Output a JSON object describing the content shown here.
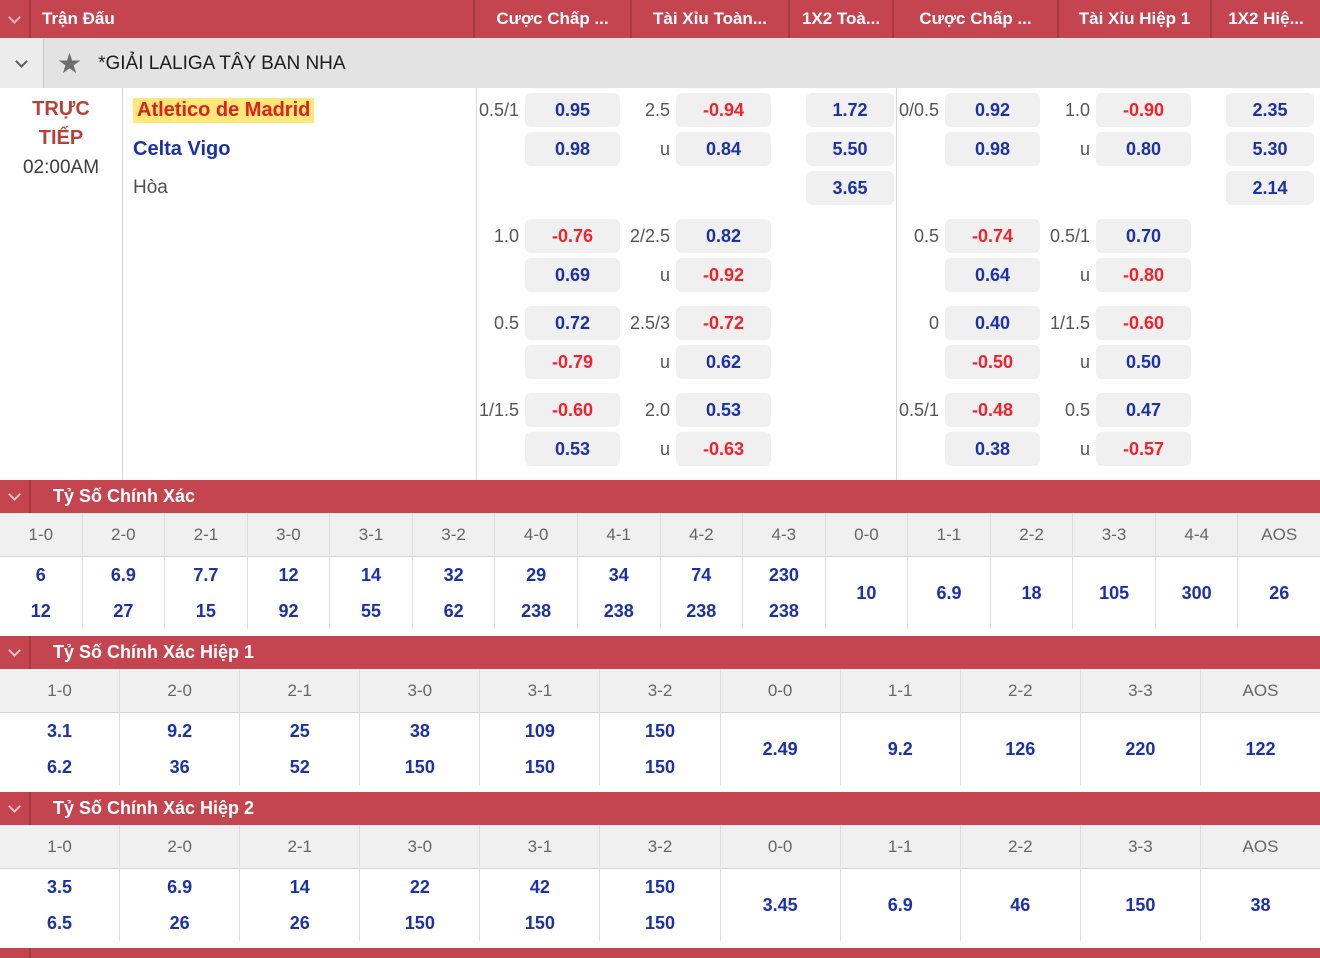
{
  "header": {
    "columns": [
      "Trận Đấu",
      "Cược Chấp ...",
      "Tài Xỉu Toàn...",
      "1X2 Toà...",
      "Cược Chấp ...",
      "Tài Xỉu Hiệp 1",
      "1X2 Hiệ..."
    ]
  },
  "league": {
    "title": "*GIẢI LALIGA TÂY BAN NHA"
  },
  "match": {
    "status_line1": "TRỰC",
    "status_line2": "TIẾP",
    "time": "02:00AM",
    "home_team": "Atletico de Madrid",
    "away_team": "Celta Vigo",
    "draw_label": "Hòa",
    "under_label": "u",
    "odds_groups": [
      {
        "name": "full-time",
        "rows": [
          {
            "hc_line": "0.5/1",
            "hc": [
              "0.95",
              "0.98"
            ],
            "ou_line": "2.5",
            "ou": [
              "-0.94",
              "0.84"
            ],
            "x12": [
              "1.72",
              "5.50",
              "3.65"
            ]
          },
          {
            "hc_line": "1.0",
            "hc": [
              "-0.76",
              "0.69"
            ],
            "ou_line": "2/2.5",
            "ou": [
              "0.82",
              "-0.92"
            ]
          },
          {
            "hc_line": "0.5",
            "hc": [
              "0.72",
              "-0.79"
            ],
            "ou_line": "2.5/3",
            "ou": [
              "-0.72",
              "0.62"
            ]
          },
          {
            "hc_line": "1/1.5",
            "hc": [
              "-0.60",
              "0.53"
            ],
            "ou_line": "2.0",
            "ou": [
              "0.53",
              "-0.63"
            ]
          }
        ]
      },
      {
        "name": "first-half",
        "rows": [
          {
            "hc_line": "0/0.5",
            "hc": [
              "0.92",
              "0.98"
            ],
            "ou_line": "1.0",
            "ou": [
              "-0.90",
              "0.80"
            ],
            "x12": [
              "2.35",
              "5.30",
              "2.14"
            ]
          },
          {
            "hc_line": "0.5",
            "hc": [
              "-0.74",
              "0.64"
            ],
            "ou_line": "0.5/1",
            "ou": [
              "0.70",
              "-0.80"
            ]
          },
          {
            "hc_line": "0",
            "hc": [
              "0.40",
              "-0.50"
            ],
            "ou_line": "1/1.5",
            "ou": [
              "-0.60",
              "0.50"
            ]
          },
          {
            "hc_line": "0.5/1",
            "hc": [
              "-0.48",
              "0.38"
            ],
            "ou_line": "0.5",
            "ou": [
              "0.47",
              "-0.57"
            ]
          }
        ]
      }
    ]
  },
  "score_sections": [
    {
      "title": "Tỷ Số Chính Xác",
      "columns": [
        {
          "score": "1-0",
          "odds": [
            "6",
            "12"
          ]
        },
        {
          "score": "2-0",
          "odds": [
            "6.9",
            "27"
          ]
        },
        {
          "score": "2-1",
          "odds": [
            "7.7",
            "15"
          ]
        },
        {
          "score": "3-0",
          "odds": [
            "12",
            "92"
          ]
        },
        {
          "score": "3-1",
          "odds": [
            "14",
            "55"
          ]
        },
        {
          "score": "3-2",
          "odds": [
            "32",
            "62"
          ]
        },
        {
          "score": "4-0",
          "odds": [
            "29",
            "238"
          ]
        },
        {
          "score": "4-1",
          "odds": [
            "34",
            "238"
          ]
        },
        {
          "score": "4-2",
          "odds": [
            "74",
            "238"
          ]
        },
        {
          "score": "4-3",
          "odds": [
            "230",
            "238"
          ]
        },
        {
          "score": "0-0",
          "odds": [
            "10"
          ]
        },
        {
          "score": "1-1",
          "odds": [
            "6.9"
          ]
        },
        {
          "score": "2-2",
          "odds": [
            "18"
          ]
        },
        {
          "score": "3-3",
          "odds": [
            "105"
          ]
        },
        {
          "score": "4-4",
          "odds": [
            "300"
          ]
        },
        {
          "score": "AOS",
          "odds": [
            "26"
          ]
        }
      ]
    },
    {
      "title": "Tỷ Số Chính Xác Hiệp 1",
      "columns": [
        {
          "score": "1-0",
          "odds": [
            "3.1",
            "6.2"
          ]
        },
        {
          "score": "2-0",
          "odds": [
            "9.2",
            "36"
          ]
        },
        {
          "score": "2-1",
          "odds": [
            "25",
            "52"
          ]
        },
        {
          "score": "3-0",
          "odds": [
            "38",
            "150"
          ]
        },
        {
          "score": "3-1",
          "odds": [
            "109",
            "150"
          ]
        },
        {
          "score": "3-2",
          "odds": [
            "150",
            "150"
          ]
        },
        {
          "score": "0-0",
          "odds": [
            "2.49"
          ]
        },
        {
          "score": "1-1",
          "odds": [
            "9.2"
          ]
        },
        {
          "score": "2-2",
          "odds": [
            "126"
          ]
        },
        {
          "score": "3-3",
          "odds": [
            "220"
          ]
        },
        {
          "score": "AOS",
          "odds": [
            "122"
          ]
        }
      ]
    },
    {
      "title": "Tỷ Số Chính Xác Hiệp 2",
      "columns": [
        {
          "score": "1-0",
          "odds": [
            "3.5",
            "6.5"
          ]
        },
        {
          "score": "2-0",
          "odds": [
            "6.9",
            "26"
          ]
        },
        {
          "score": "2-1",
          "odds": [
            "14",
            "26"
          ]
        },
        {
          "score": "3-0",
          "odds": [
            "22",
            "150"
          ]
        },
        {
          "score": "3-1",
          "odds": [
            "42",
            "150"
          ]
        },
        {
          "score": "3-2",
          "odds": [
            "150",
            "150"
          ]
        },
        {
          "score": "0-0",
          "odds": [
            "3.45"
          ]
        },
        {
          "score": "1-1",
          "odds": [
            "6.9"
          ]
        },
        {
          "score": "2-2",
          "odds": [
            "46"
          ]
        },
        {
          "score": "3-3",
          "odds": [
            "150"
          ]
        },
        {
          "score": "AOS",
          "odds": [
            "38"
          ]
        }
      ]
    }
  ],
  "colors": {
    "accent_red": "#C4454F",
    "accent_red_dark": "#A53A43",
    "odds_blue": "#1B31A5",
    "odds_neg": "#F2222B",
    "team_red": "#E01F1F",
    "hl_yellow": "#FFE87A",
    "live_red": "#B5413B"
  }
}
